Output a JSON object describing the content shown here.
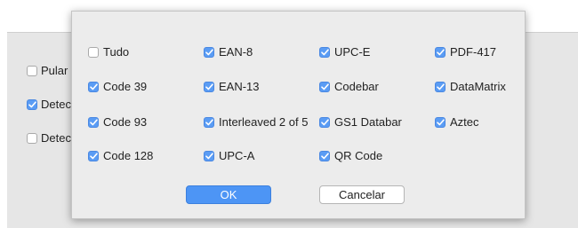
{
  "background": {
    "options": [
      {
        "label": "Pular c",
        "checked": false
      },
      {
        "label": "Detect",
        "checked": true
      },
      {
        "label": "Detect",
        "checked": false
      }
    ]
  },
  "dialog": {
    "options": [
      {
        "label": "Tudo",
        "checked": false
      },
      {
        "label": "EAN-8",
        "checked": true
      },
      {
        "label": "UPC-E",
        "checked": true
      },
      {
        "label": "PDF-417",
        "checked": true
      },
      {
        "label": "Code 39",
        "checked": true
      },
      {
        "label": "EAN-13",
        "checked": true
      },
      {
        "label": "Codebar",
        "checked": true
      },
      {
        "label": "DataMatrix",
        "checked": true
      },
      {
        "label": "Code 93",
        "checked": true
      },
      {
        "label": "Interleaved 2 of 5",
        "checked": true
      },
      {
        "label": "GS1 Databar",
        "checked": true
      },
      {
        "label": "Aztec",
        "checked": true
      },
      {
        "label": "Code 128",
        "checked": true
      },
      {
        "label": "UPC-A",
        "checked": true
      },
      {
        "label": "QR Code",
        "checked": true
      }
    ],
    "ok_label": "OK",
    "cancel_label": "Cancelar"
  },
  "colors": {
    "accent": "#5a9cf4",
    "dialog_bg": "#ececec",
    "panel_bg": "#e6e6e6"
  }
}
